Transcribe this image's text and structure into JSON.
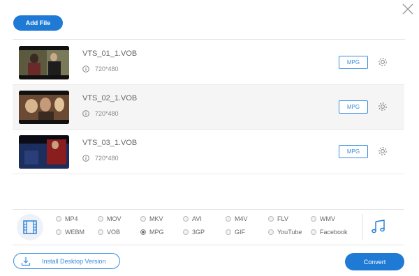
{
  "toolbar": {
    "add_file_label": "Add File"
  },
  "files": [
    {
      "name": "VTS_01_1.VOB",
      "resolution": "720*480",
      "format": "MPG"
    },
    {
      "name": "VTS_02_1.VOB",
      "resolution": "720*480",
      "format": "MPG"
    },
    {
      "name": "VTS_03_1.VOB",
      "resolution": "720*480",
      "format": "MPG"
    }
  ],
  "formats": {
    "row1": [
      "MP4",
      "MOV",
      "MKV",
      "AVI",
      "M4V",
      "FLV",
      "WMV"
    ],
    "row2": [
      "WEBM",
      "VOB",
      "MPG",
      "3GP",
      "GIF",
      "YouTube",
      "Facebook"
    ],
    "selected": "MPG"
  },
  "footer": {
    "install_label": "Install Desktop Version",
    "convert_label": "Convert"
  },
  "colors": {
    "accent": "#1f7ad6",
    "outline": "#3a8ee0"
  }
}
